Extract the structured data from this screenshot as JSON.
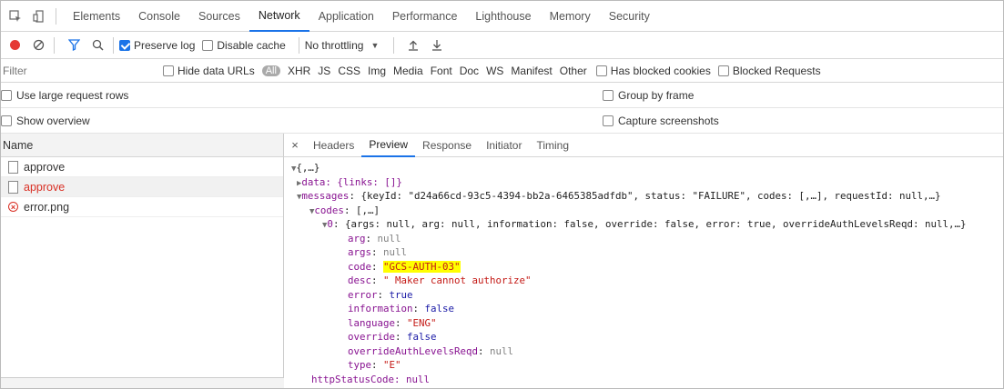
{
  "tabbar": {
    "tabs": [
      "Elements",
      "Console",
      "Sources",
      "Network",
      "Application",
      "Performance",
      "Lighthouse",
      "Memory",
      "Security"
    ],
    "active": "Network"
  },
  "toolbar": {
    "preserve_log": "Preserve log",
    "disable_cache": "Disable cache",
    "throttling": "No throttling"
  },
  "filter": {
    "placeholder": "Filter",
    "hide_data_urls": "Hide data URLs",
    "all": "All",
    "types": [
      "XHR",
      "JS",
      "CSS",
      "Img",
      "Media",
      "Font",
      "Doc",
      "WS",
      "Manifest",
      "Other"
    ],
    "has_blocked_cookies": "Has blocked cookies",
    "blocked_requests": "Blocked Requests"
  },
  "settings": {
    "large_rows": "Use large request rows",
    "group_by_frame": "Group by frame",
    "show_overview": "Show overview",
    "capture_screenshots": "Capture screenshots"
  },
  "requests": {
    "header": "Name",
    "items": [
      {
        "name": "approve",
        "state": "normal"
      },
      {
        "name": "approve",
        "state": "error"
      },
      {
        "name": "error.png",
        "state": "failed"
      }
    ]
  },
  "details": {
    "tabs": [
      "Headers",
      "Preview",
      "Response",
      "Initiator",
      "Timing"
    ],
    "active": "Preview"
  },
  "preview": {
    "root": "{,…}",
    "data_line": "data: {links: []}",
    "messages_key": "messages",
    "messages_summary": "{keyId: \"d24a66cd-93c5-4394-bb2a-6465385adfdb\", status: \"FAILURE\", codes: [,…], requestId: null,…}",
    "codes_key": "codes",
    "codes_summary": "[,…]",
    "item_key": "0",
    "item_summary": "{args: null, arg: null, information: false, override: false, error: true, overrideAuthLevelsReqd: null,…}",
    "fields": [
      {
        "k": "arg",
        "v": "null",
        "t": "nul"
      },
      {
        "k": "args",
        "v": "null",
        "t": "nul"
      },
      {
        "k": "code",
        "v": "\"GCS-AUTH-03\"",
        "t": "str",
        "hl": true
      },
      {
        "k": "desc",
        "v": "\" Maker cannot authorize\"",
        "t": "str"
      },
      {
        "k": "error",
        "v": "true",
        "t": "kw"
      },
      {
        "k": "information",
        "v": "false",
        "t": "kw"
      },
      {
        "k": "language",
        "v": "\"ENG\"",
        "t": "str"
      },
      {
        "k": "override",
        "v": "false",
        "t": "kw"
      },
      {
        "k": "overrideAuthLevelsReqd",
        "v": "null",
        "t": "nul"
      },
      {
        "k": "type",
        "v": "\"E\"",
        "t": "str"
      }
    ],
    "cut_line": "httpStatusCode: null"
  },
  "colors": {
    "accent": "#1a73e8",
    "error": "#d93025",
    "highlight": "#ffff00",
    "record": "#e53935"
  }
}
